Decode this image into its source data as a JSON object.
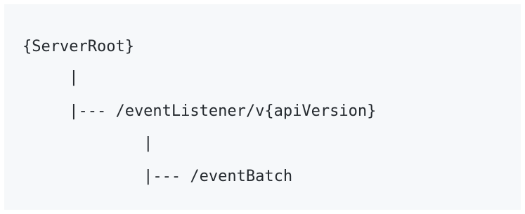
{
  "code_block": {
    "lines": [
      "{ServerRoot}",
      "     |",
      "     |--- /eventListener/v{apiVersion}",
      "             |",
      "             |--- /eventBatch"
    ]
  }
}
